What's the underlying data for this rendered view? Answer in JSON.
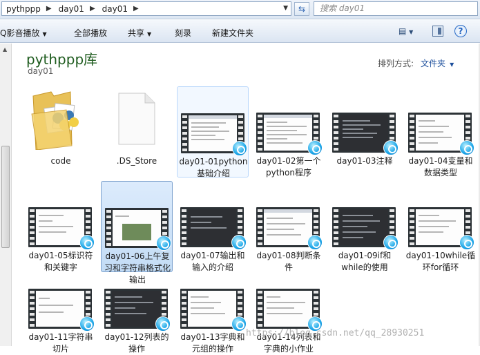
{
  "address": {
    "crumbs": [
      "pythppp",
      "day01",
      "day01"
    ]
  },
  "search": {
    "placeholder": "搜索 day01"
  },
  "commands": {
    "play_group": "Q影音播放",
    "play_all": "全部播放",
    "share": "共享",
    "burn": "刻录",
    "new_folder": "新建文件夹"
  },
  "library": {
    "title": "pythppp库",
    "subtitle": "day01",
    "arrange_label": "排列方式:",
    "arrange_value": "文件夹"
  },
  "items": [
    {
      "label": "code",
      "type": "folder"
    },
    {
      "label": ".DS_Store",
      "type": "file"
    },
    {
      "label": "day01-01python基础介绍",
      "type": "video"
    },
    {
      "label": "day01-02第一个python程序",
      "type": "video"
    },
    {
      "label": "day01-03注释",
      "type": "video"
    },
    {
      "label": "day01-04变量和数据类型",
      "type": "video"
    },
    {
      "label": "day01-05标识符和关键字",
      "type": "video"
    },
    {
      "label": "day01-06上午复习和字符串格式化输出",
      "type": "video"
    },
    {
      "label": "day01-07输出和输入的介绍",
      "type": "video"
    },
    {
      "label": "day01-08判断条件",
      "type": "video"
    },
    {
      "label": "day01-09if和while的使用",
      "type": "video"
    },
    {
      "label": "day01-10while循环for循环",
      "type": "video"
    },
    {
      "label": "day01-11字符串切片",
      "type": "video"
    },
    {
      "label": "day01-12列表的操作",
      "type": "video"
    },
    {
      "label": "day01-13字典和元组的操作",
      "type": "video"
    },
    {
      "label": "day01-14列表和字典的小作业",
      "type": "video"
    }
  ],
  "watermark": "https://blog.csdn.net/qq_28930251"
}
